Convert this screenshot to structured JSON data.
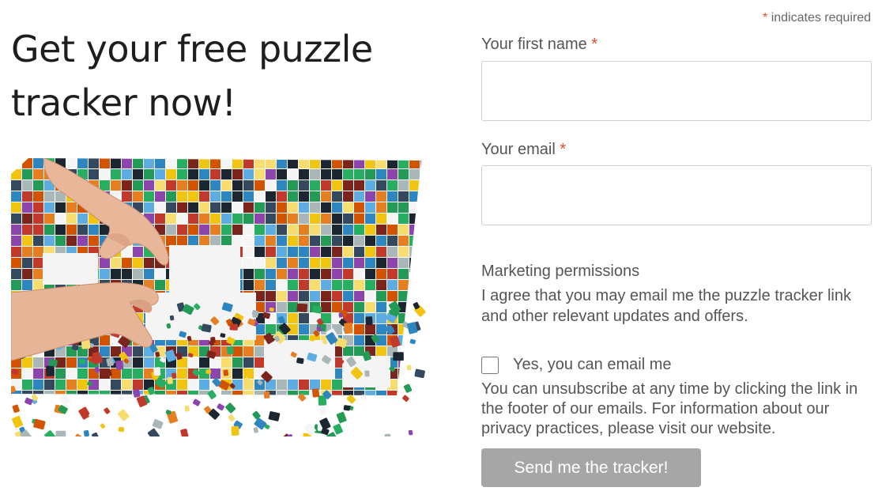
{
  "heading": {
    "line1": "Get your free puzzle",
    "line2": "tracker now!"
  },
  "image": {
    "description_icon": "puzzle-photo"
  },
  "form": {
    "required_star": "*",
    "required_note": "indicates required",
    "first_name_label": "Your first name",
    "first_name_value": "",
    "email_label": "Your email",
    "email_value": "",
    "marketing_title": "Marketing permissions",
    "marketing_text": "I agree that you may email me the puzzle tracker link and other relevant updates and offers.",
    "consent_label": "Yes, you can email me",
    "consent_checked": false,
    "fine_print": "You can unsubscribe at any time by clicking the link in the footer of our emails. For information about our privacy practices, please visit our website.",
    "submit_label": "Send me the tracker!"
  },
  "colors": {
    "required_star": "#e04a2a",
    "button_bg": "#a6a6a6",
    "button_text": "#ffffff",
    "heading": "#1e1e1e",
    "body_text": "#555555"
  }
}
